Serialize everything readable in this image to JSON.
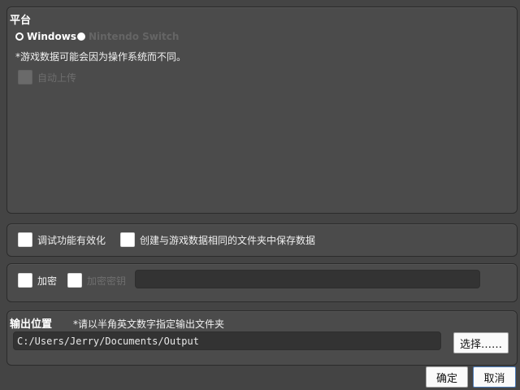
{
  "platform": {
    "title": "平台",
    "options": [
      {
        "label": "Windows",
        "selected": true
      },
      {
        "label": "Nintendo Switch",
        "selected": false
      }
    ],
    "note": "*游戏数据可能会因为操作系统而不同。",
    "auto_upload_label": "自动上传"
  },
  "options": {
    "debug_label": "调试功能有效化",
    "save_folder_label": "创建与游戏数据相同的文件夹中保存数据"
  },
  "encryption": {
    "encrypt_label": "加密",
    "key_label": "加密密钥",
    "key_value": ""
  },
  "output": {
    "title": "输出位置",
    "hint": "*请以半角英文数字指定输出文件夹",
    "path": "C:/Users/Jerry/Documents/Output",
    "choose_label": "选择……"
  },
  "footer": {
    "ok_label": "确定",
    "cancel_label": "取消"
  },
  "colors": {
    "background": "#444444",
    "panel": "#4b4b4b",
    "field": "#333333",
    "accent_border": "#4a7ab8"
  }
}
